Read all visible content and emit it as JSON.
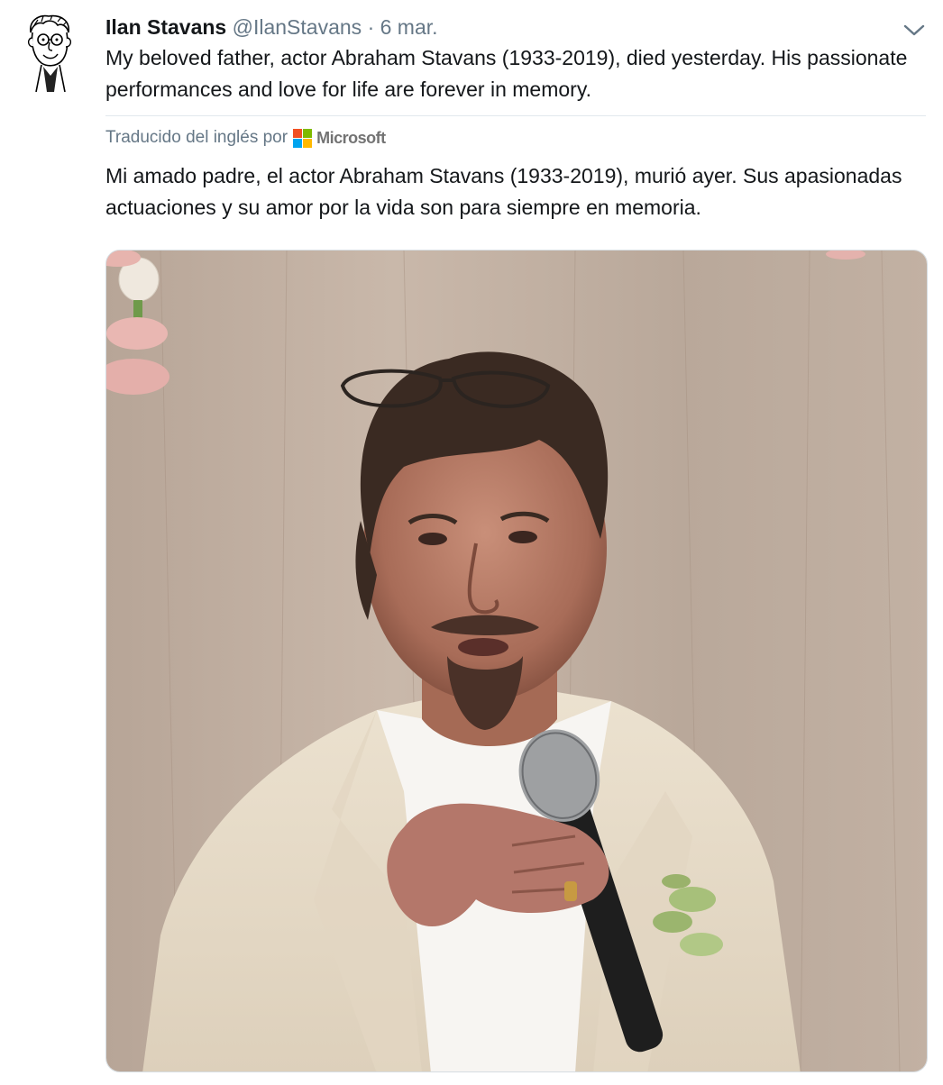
{
  "tweet": {
    "author_name": "Ilan Stavans",
    "author_handle": "@IlanStavans",
    "separator": "·",
    "date": "6 mar.",
    "text_original": "My beloved father, actor Abraham Stavans (1933-2019), died yesterday. His passionate performances and love for life are forever in memory.",
    "translation_label": "Traducido del inglés por",
    "translation_provider": "Microsoft",
    "text_translated": "Mi amado padre, el actor Abraham Stavans (1933-2019), murió ayer. Sus apasionadas actuaciones y su amor por la vida son para siempre en memoria."
  },
  "icons": {
    "avatar": "caricature-avatar",
    "menu": "chevron-down-icon",
    "provider_logo": "microsoft-logo"
  },
  "colors": {
    "text_primary": "#14171a",
    "text_secondary": "#657786",
    "divider": "#e1e8ed",
    "ms_red": "#f25022",
    "ms_green": "#7fba00",
    "ms_blue": "#00a4ef",
    "ms_yellow": "#ffb900"
  }
}
